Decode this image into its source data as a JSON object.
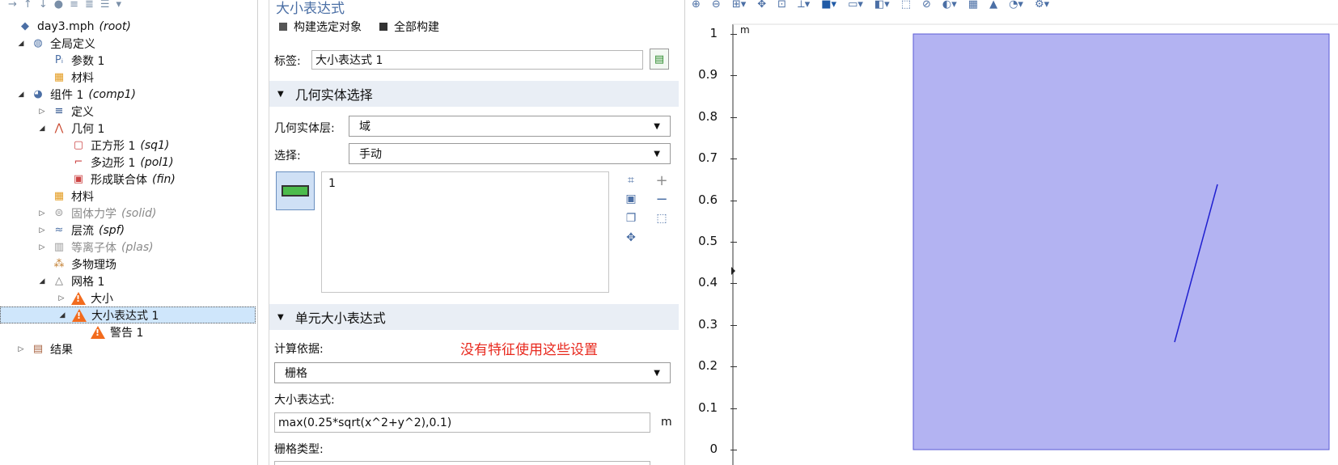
{
  "tree": {
    "toolbar_icons": [
      "arrow-right-icon",
      "arrow-up-icon",
      "arrow-down-icon",
      "eye-icon",
      "sort-up-icon",
      "sort-down-icon",
      "list-icon",
      "dropdown-icon"
    ],
    "nodes": [
      {
        "label": "day3.mph",
        "tag": "(root)",
        "exp": "",
        "icon": "model-icon",
        "level": 0,
        "dim": false
      },
      {
        "label": "全局定义",
        "tag": "",
        "exp": "◢",
        "icon": "globe-icon",
        "level": 1,
        "dim": false
      },
      {
        "label": "参数 1",
        "tag": "",
        "exp": "",
        "icon": "parameters-icon",
        "level": 2,
        "dim": false
      },
      {
        "label": "材料",
        "tag": "",
        "exp": "",
        "icon": "materials-icon",
        "level": 2,
        "dim": false
      },
      {
        "label": "组件 1",
        "tag": "(comp1)",
        "exp": "◢",
        "icon": "component-icon",
        "level": 1,
        "dim": false
      },
      {
        "label": "定义",
        "tag": "",
        "exp": "▷",
        "icon": "definitions-icon",
        "level": 2,
        "dim": false
      },
      {
        "label": "几何 1",
        "tag": "",
        "exp": "◢",
        "icon": "geometry-icon",
        "level": 2,
        "dim": false
      },
      {
        "label": "正方形 1",
        "tag": "(sq1)",
        "exp": "",
        "icon": "square-icon",
        "level": 3,
        "dim": false
      },
      {
        "label": "多边形 1",
        "tag": "(pol1)",
        "exp": "",
        "icon": "polygon-icon",
        "level": 3,
        "dim": false
      },
      {
        "label": "形成联合体",
        "tag": "(fin)",
        "exp": "",
        "icon": "union-icon",
        "level": 3,
        "dim": false
      },
      {
        "label": "材料",
        "tag": "",
        "exp": "",
        "icon": "materials-icon",
        "level": 2,
        "dim": false
      },
      {
        "label": "固体力学",
        "tag": "(solid)",
        "exp": "▷",
        "icon": "solid-mechanics-icon",
        "level": 2,
        "dim": true
      },
      {
        "label": "层流",
        "tag": "(spf)",
        "exp": "▷",
        "icon": "laminar-flow-icon",
        "level": 2,
        "dim": false
      },
      {
        "label": "等离子体",
        "tag": "(plas)",
        "exp": "▷",
        "icon": "plasma-icon",
        "level": 2,
        "dim": true
      },
      {
        "label": "多物理场",
        "tag": "",
        "exp": "",
        "icon": "multiphysics-icon",
        "level": 2,
        "dim": false
      },
      {
        "label": "网格 1",
        "tag": "",
        "exp": "◢",
        "icon": "mesh-icon",
        "level": 2,
        "dim": false
      },
      {
        "label": "大小",
        "tag": "",
        "exp": "▷",
        "icon": "warning-icon",
        "level": 3,
        "dim": false
      },
      {
        "label": "大小表达式 1",
        "tag": "",
        "exp": "◢",
        "icon": "warning-icon",
        "level": 3,
        "dim": false,
        "selected": true
      },
      {
        "label": "警告 1",
        "tag": "",
        "exp": "",
        "icon": "warning-icon",
        "level": 4,
        "dim": false
      },
      {
        "label": "结果",
        "tag": "",
        "exp": "▷",
        "icon": "results-icon",
        "level": 1,
        "dim": false
      }
    ]
  },
  "settings": {
    "title": "大小表达式",
    "build_selected": "构建选定对象",
    "build_all": "全部构建",
    "label_caption": "标签:",
    "label_value": "大小表达式 1",
    "section_geom": "几何实体选择",
    "geom_level_caption": "几何实体层:",
    "geom_level_value": "域",
    "selection_caption": "选择:",
    "selection_value": "手动",
    "selection_list": [
      "1"
    ],
    "section_expr": "单元大小表达式",
    "calc_basis_caption": "计算依据:",
    "annotation": "没有特征使用这些设置",
    "calc_basis_value": "栅格",
    "size_expr_caption": "大小表达式:",
    "size_expr_value": "max(0.25*sqrt(x^2+y^2),0.1)",
    "size_expr_unit": "m",
    "grid_type_caption": "栅格类型:"
  },
  "graphics": {
    "unit": "m",
    "yticks": [
      "1",
      "0.9",
      "0.8",
      "0.7",
      "0.6",
      "0.5",
      "0.4",
      "0.3",
      "0.2",
      "0.1",
      "0"
    ],
    "domain_fill": "#b3b3f2",
    "domain_stroke": "#5b5bd6",
    "line_color": "#1f1fd0"
  }
}
